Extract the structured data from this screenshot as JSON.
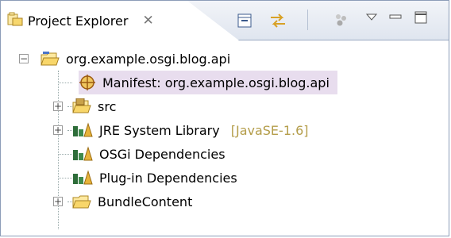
{
  "view": {
    "title": "Project Explorer",
    "close_glyph": "✕",
    "toolbar_icons": [
      "collapse-all-icon",
      "link-with-editor-icon",
      "filters-icon",
      "view-menu-icon",
      "minimize-icon",
      "maximize-icon"
    ]
  },
  "tree": {
    "items": [
      {
        "label": "org.example.osgi.blog.api",
        "icon": "project-folder-icon",
        "expander": "−"
      },
      {
        "label": "Manifest: org.example.osgi.blog.api",
        "icon": "manifest-icon",
        "selected": true
      },
      {
        "label": "src",
        "icon": "source-folder-icon",
        "expander": "+"
      },
      {
        "label": "JRE System Library",
        "decoration": "[JavaSE-1.6]",
        "icon": "library-icon",
        "expander": "+"
      },
      {
        "label": "OSGi Dependencies",
        "icon": "library-icon"
      },
      {
        "label": "Plug-in Dependencies",
        "icon": "library-icon"
      },
      {
        "label": "BundleContent",
        "icon": "folder-icon",
        "expander": "+"
      }
    ]
  },
  "colors": {
    "selection": "#e8ddee",
    "decoration": "#b49d4a",
    "border": "#8c9db8"
  }
}
